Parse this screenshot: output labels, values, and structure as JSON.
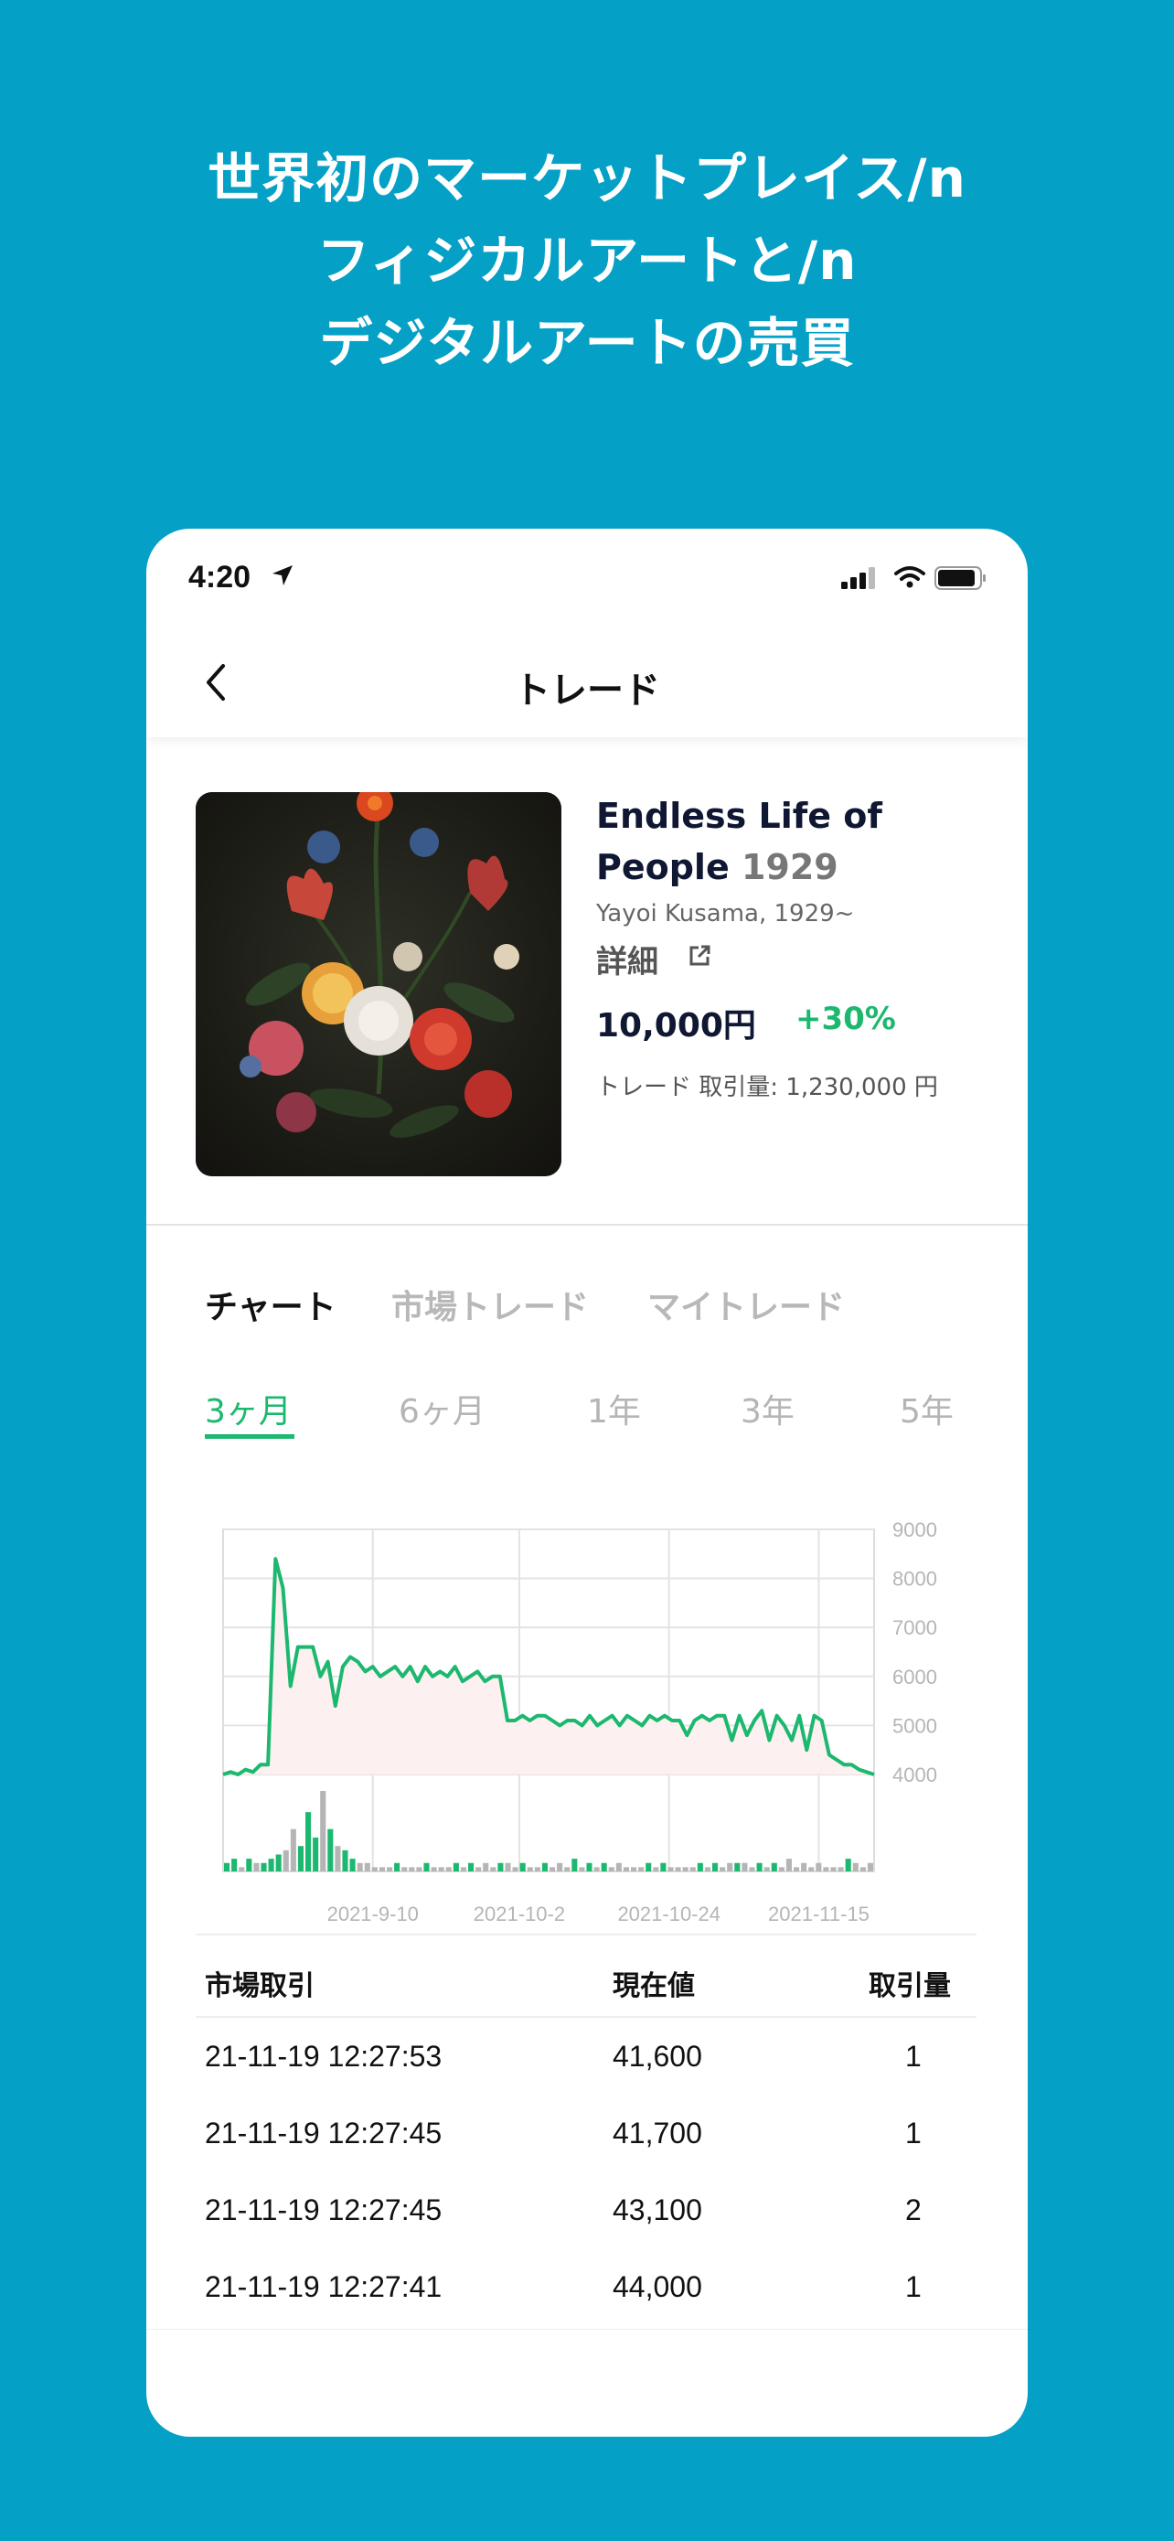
{
  "headline": {
    "line1": "世界初のマーケットプレイス/n",
    "line2": "フィジカルアートと/n",
    "line3": "デジタルアートの売買"
  },
  "status_bar": {
    "time": "4:20"
  },
  "navbar": {
    "title": "トレード"
  },
  "artwork": {
    "title": "Endless Life of People",
    "year": "1929",
    "artist": "Yayoi Kusama, 1929~",
    "detail_label": "詳細",
    "price": "10,000円",
    "change": "+30%",
    "volume": "トレード 取引量: 1,230,000 円"
  },
  "tabs": [
    "チャート",
    "市場トレード",
    "マイトレード"
  ],
  "ranges": [
    "3ヶ月",
    "6ヶ月",
    "1年",
    "3年",
    "5年"
  ],
  "chart_data": {
    "type": "line",
    "y_ticks": [
      "9000",
      "8000",
      "7000",
      "6000",
      "5000",
      "4000"
    ],
    "ylim": [
      4000,
      9000
    ],
    "x_ticks": [
      "2021-9-10",
      "2021-10-2",
      "2021-10-24",
      "2021-11-15"
    ],
    "colors": {
      "line": "#1DB86F",
      "fill": "#FDF0F0",
      "volume_up": "#1DB86F",
      "volume_flat": "#B5B5B5"
    },
    "series": [
      {
        "values": [
          4000,
          4050,
          4000,
          4100,
          4050,
          4200,
          4200,
          8400,
          7800,
          5800,
          6600,
          6600,
          6600,
          6000,
          6300,
          5400,
          6200,
          6400,
          6300,
          6100,
          6200,
          6000,
          6100,
          6200,
          6000,
          6200,
          5900,
          6200,
          6000,
          6100,
          6000,
          6200,
          5900,
          6000,
          6100,
          5900,
          6000,
          6000,
          5100,
          5100,
          5200,
          5100,
          5200,
          5200,
          5100,
          5000,
          5100,
          5100,
          5000,
          5200,
          5000,
          5100,
          5200,
          5000,
          5200,
          5100,
          5000,
          5200,
          5100,
          5200,
          5100,
          5100,
          4800,
          5100,
          5200,
          5100,
          5200,
          5200,
          4700,
          5200,
          4800,
          5100,
          5300,
          4700,
          5200,
          5000,
          4700,
          5200,
          4500,
          5200,
          5100,
          4400,
          4300,
          4200,
          4200,
          4100,
          4050,
          4000
        ]
      }
    ],
    "volume": [
      2,
      3,
      1,
      3,
      2,
      2,
      3,
      4,
      5,
      10,
      6,
      14,
      8,
      19,
      10,
      6,
      5,
      3,
      2,
      2,
      1,
      1,
      1,
      2,
      1,
      1,
      1,
      2,
      1,
      1,
      1,
      2,
      1,
      2,
      1,
      2,
      1,
      2,
      2,
      1,
      2,
      1,
      1,
      2,
      1,
      2,
      1,
      3,
      1,
      2,
      1,
      2,
      1,
      2,
      1,
      1,
      1,
      2,
      1,
      2,
      1,
      1,
      1,
      1,
      2,
      1,
      2,
      1,
      2,
      2,
      2,
      1,
      2,
      1,
      2,
      1,
      3,
      1,
      2,
      1,
      2,
      1,
      1,
      1,
      3,
      2,
      1,
      2
    ]
  },
  "table": {
    "headers": {
      "market": "市場取引",
      "price": "現在値",
      "qty": "取引量"
    },
    "rows": [
      {
        "datetime": "21-11-19  12:27:53",
        "price": "41,600",
        "qty": "1"
      },
      {
        "datetime": "21-11-19  12:27:45",
        "price": "41,700",
        "qty": "1"
      },
      {
        "datetime": "21-11-19  12:27:45",
        "price": "43,100",
        "qty": "2"
      },
      {
        "datetime": "21-11-19  12:27:41",
        "price": "44,000",
        "qty": "1"
      }
    ]
  }
}
